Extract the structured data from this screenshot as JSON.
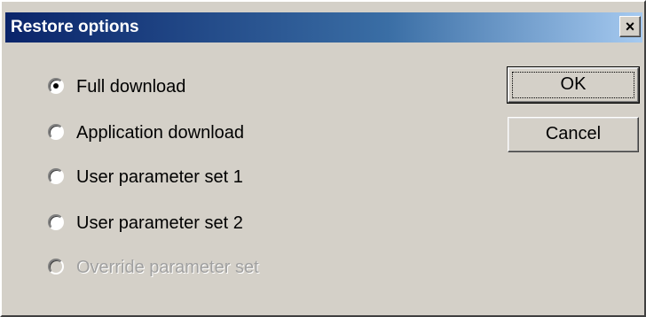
{
  "window": {
    "title": "Restore options",
    "close_glyph": "✕"
  },
  "options": [
    {
      "label": "Full download",
      "selected": true,
      "enabled": true
    },
    {
      "label": "Application download",
      "selected": false,
      "enabled": true
    },
    {
      "label": "User parameter set 1",
      "selected": false,
      "enabled": true
    },
    {
      "label": "User parameter set 2",
      "selected": false,
      "enabled": true
    },
    {
      "label": "Override parameter set",
      "selected": false,
      "enabled": false
    }
  ],
  "buttons": {
    "ok_label": "OK",
    "cancel_label": "Cancel"
  },
  "colors": {
    "title_gradient_start": "#0a246a",
    "title_gradient_end": "#a6caf0",
    "face": "#d4d0c8",
    "disabled_text": "#a0a0a0"
  }
}
